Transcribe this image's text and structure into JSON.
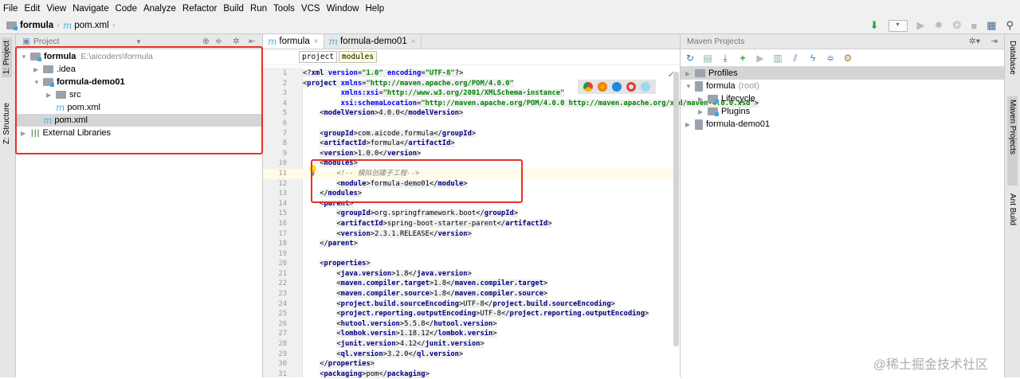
{
  "menu": [
    "File",
    "Edit",
    "View",
    "Navigate",
    "Code",
    "Analyze",
    "Refactor",
    "Build",
    "Run",
    "Tools",
    "VCS",
    "Window",
    "Help"
  ],
  "nav": {
    "project": "formula",
    "file": "pom.xml"
  },
  "left_strip": {
    "project_tab": "1: Project",
    "structure_tab": "Z: Structure"
  },
  "project_panel": {
    "title": "Project",
    "tree": [
      {
        "label": "formula",
        "hint": "E:\\aicoders\\formula",
        "bold": true,
        "depth": 0,
        "arrow": "▼",
        "icon": "module-folder"
      },
      {
        "label": ".idea",
        "depth": 1,
        "arrow": "▶",
        "icon": "folder"
      },
      {
        "label": "formula-demo01",
        "bold": true,
        "depth": 1,
        "arrow": "▼",
        "icon": "module-folder"
      },
      {
        "label": "src",
        "depth": 2,
        "arrow": "▶",
        "icon": "folder"
      },
      {
        "label": "pom.xml",
        "depth": 2,
        "arrow": "",
        "icon": "maven"
      },
      {
        "label": "pom.xml",
        "depth": 1,
        "arrow": "",
        "icon": "maven",
        "selected": true
      },
      {
        "label": "External Libraries",
        "depth": 0,
        "arrow": "▶",
        "icon": "library"
      }
    ]
  },
  "editor": {
    "tabs": [
      {
        "label": "formula",
        "active": true
      },
      {
        "label": "formula-demo01",
        "active": false
      }
    ],
    "breadcrumbs": [
      "project",
      "modules"
    ],
    "lines": [
      [
        [
          "br",
          "<?"
        ],
        [
          "tag",
          "xml "
        ],
        [
          "attr",
          "version"
        ],
        [
          "br",
          "="
        ],
        [
          "val",
          "\"1.0\" "
        ],
        [
          "attr",
          "encoding"
        ],
        [
          "br",
          "="
        ],
        [
          "val",
          "\"UTF-8\""
        ],
        [
          "br",
          "?>"
        ]
      ],
      [
        [
          "br",
          "<"
        ],
        [
          "tag",
          "project "
        ],
        [
          "attr",
          "xmlns"
        ],
        [
          "br",
          "="
        ],
        [
          "val",
          "\"http://maven.apache.org/POM/4.0.0\""
        ]
      ],
      [
        [
          "txt",
          "         "
        ],
        [
          "attr",
          "xmlns:xsi"
        ],
        [
          "br",
          "="
        ],
        [
          "val",
          "\"http://www.w3.org/2001/XMLSchema-instance\""
        ]
      ],
      [
        [
          "txt",
          "         "
        ],
        [
          "attr",
          "xsi:schemaLocation"
        ],
        [
          "br",
          "="
        ],
        [
          "val",
          "\"http://maven.apache.org/POM/4.0.0 http://maven.apache.org/xsd/maven-4.0.0.xsd\""
        ],
        [
          "br",
          ">"
        ]
      ],
      [
        [
          "txt",
          "    "
        ],
        [
          "br",
          "<"
        ],
        [
          "tag",
          "modelVersion"
        ],
        [
          "br",
          ">"
        ],
        [
          "txt",
          "4.0.0"
        ],
        [
          "br",
          "</"
        ],
        [
          "tag",
          "modelVersion"
        ],
        [
          "br",
          ">"
        ]
      ],
      [],
      [
        [
          "txt",
          "    "
        ],
        [
          "br",
          "<"
        ],
        [
          "tag",
          "groupId"
        ],
        [
          "br",
          ">"
        ],
        [
          "txt",
          "com.aicode.formula"
        ],
        [
          "br",
          "</"
        ],
        [
          "tag",
          "groupId"
        ],
        [
          "br",
          ">"
        ]
      ],
      [
        [
          "txt",
          "    "
        ],
        [
          "br",
          "<"
        ],
        [
          "tag",
          "artifactId"
        ],
        [
          "br",
          ">"
        ],
        [
          "txt",
          "formula"
        ],
        [
          "br",
          "</"
        ],
        [
          "tag",
          "artifactId"
        ],
        [
          "br",
          ">"
        ]
      ],
      [
        [
          "txt",
          "    "
        ],
        [
          "br",
          "<"
        ],
        [
          "tag",
          "version"
        ],
        [
          "br",
          ">"
        ],
        [
          "txt",
          "1.0.0"
        ],
        [
          "br",
          "</"
        ],
        [
          "tag",
          "version"
        ],
        [
          "br",
          ">"
        ]
      ],
      [
        [
          "txt",
          "    "
        ],
        [
          "br",
          "<"
        ],
        [
          "tag",
          "modules"
        ],
        [
          "br",
          ">"
        ]
      ],
      [
        [
          "txt",
          "        "
        ],
        [
          "cm",
          "<!-- 模拟创建子工程-->"
        ]
      ],
      [
        [
          "txt",
          "        "
        ],
        [
          "br",
          "<"
        ],
        [
          "tag",
          "module"
        ],
        [
          "br",
          ">"
        ],
        [
          "txt",
          "formula-demo01"
        ],
        [
          "br",
          "</"
        ],
        [
          "tag",
          "module"
        ],
        [
          "br",
          ">"
        ]
      ],
      [
        [
          "txt",
          "    "
        ],
        [
          "br",
          "</"
        ],
        [
          "tag",
          "modules"
        ],
        [
          "br",
          ">"
        ]
      ],
      [
        [
          "txt",
          "    "
        ],
        [
          "br",
          "<"
        ],
        [
          "tag",
          "parent"
        ],
        [
          "br",
          ">"
        ]
      ],
      [
        [
          "txt",
          "        "
        ],
        [
          "br",
          "<"
        ],
        [
          "tag",
          "groupId"
        ],
        [
          "br",
          ">"
        ],
        [
          "txt",
          "org.springframework.boot"
        ],
        [
          "br",
          "</"
        ],
        [
          "tag",
          "groupId"
        ],
        [
          "br",
          ">"
        ]
      ],
      [
        [
          "txt",
          "        "
        ],
        [
          "br",
          "<"
        ],
        [
          "tag",
          "artifactId"
        ],
        [
          "br",
          ">"
        ],
        [
          "txt",
          "spring-boot-starter-parent"
        ],
        [
          "br",
          "</"
        ],
        [
          "tag",
          "artifactId"
        ],
        [
          "br",
          ">"
        ]
      ],
      [
        [
          "txt",
          "        "
        ],
        [
          "br",
          "<"
        ],
        [
          "tag",
          "version"
        ],
        [
          "br",
          ">"
        ],
        [
          "txt",
          "2.3.1.RELEASE"
        ],
        [
          "br",
          "</"
        ],
        [
          "tag",
          "version"
        ],
        [
          "br",
          ">"
        ]
      ],
      [
        [
          "txt",
          "    "
        ],
        [
          "br",
          "</"
        ],
        [
          "tag",
          "parent"
        ],
        [
          "br",
          ">"
        ]
      ],
      [],
      [
        [
          "txt",
          "    "
        ],
        [
          "br",
          "<"
        ],
        [
          "tag",
          "properties"
        ],
        [
          "br",
          ">"
        ]
      ],
      [
        [
          "txt",
          "        "
        ],
        [
          "br",
          "<"
        ],
        [
          "tag",
          "java.version"
        ],
        [
          "br",
          ">"
        ],
        [
          "txt",
          "1.8"
        ],
        [
          "br",
          "</"
        ],
        [
          "tag",
          "java.version"
        ],
        [
          "br",
          ">"
        ]
      ],
      [
        [
          "txt",
          "        "
        ],
        [
          "br",
          "<"
        ],
        [
          "tag",
          "maven.compiler.target"
        ],
        [
          "br",
          ">"
        ],
        [
          "txt",
          "1.8"
        ],
        [
          "br",
          "</"
        ],
        [
          "tag",
          "maven.compiler.target"
        ],
        [
          "br",
          ">"
        ]
      ],
      [
        [
          "txt",
          "        "
        ],
        [
          "br",
          "<"
        ],
        [
          "tag",
          "maven.compiler.source"
        ],
        [
          "br",
          ">"
        ],
        [
          "txt",
          "1.8"
        ],
        [
          "br",
          "</"
        ],
        [
          "tag",
          "maven.compiler.source"
        ],
        [
          "br",
          ">"
        ]
      ],
      [
        [
          "txt",
          "        "
        ],
        [
          "br",
          "<"
        ],
        [
          "tag",
          "project.build.sourceEncoding"
        ],
        [
          "br",
          ">"
        ],
        [
          "txt",
          "UTF-8"
        ],
        [
          "br",
          "</"
        ],
        [
          "tag",
          "project.build.sourceEncoding"
        ],
        [
          "br",
          ">"
        ]
      ],
      [
        [
          "txt",
          "        "
        ],
        [
          "br",
          "<"
        ],
        [
          "tag",
          "project.reporting.outputEncoding"
        ],
        [
          "br",
          ">"
        ],
        [
          "txt",
          "UTF-8"
        ],
        [
          "br",
          "</"
        ],
        [
          "tag",
          "project.reporting.outputEncoding"
        ],
        [
          "br",
          ">"
        ]
      ],
      [
        [
          "txt",
          "        "
        ],
        [
          "br",
          "<"
        ],
        [
          "tag",
          "hutool.version"
        ],
        [
          "br",
          ">"
        ],
        [
          "txt",
          "5.5.8"
        ],
        [
          "br",
          "</"
        ],
        [
          "tag",
          "hutool.version"
        ],
        [
          "br",
          ">"
        ]
      ],
      [
        [
          "txt",
          "        "
        ],
        [
          "br",
          "<"
        ],
        [
          "tag",
          "lombok.versin"
        ],
        [
          "br",
          ">"
        ],
        [
          "txt",
          "1.18.12"
        ],
        [
          "br",
          "</"
        ],
        [
          "tag",
          "lombok.versin"
        ],
        [
          "br",
          ">"
        ]
      ],
      [
        [
          "txt",
          "        "
        ],
        [
          "br",
          "<"
        ],
        [
          "tag",
          "junit.version"
        ],
        [
          "br",
          ">"
        ],
        [
          "txt",
          "4.12"
        ],
        [
          "br",
          "</"
        ],
        [
          "tag",
          "junit.version"
        ],
        [
          "br",
          ">"
        ]
      ],
      [
        [
          "txt",
          "        "
        ],
        [
          "br",
          "<"
        ],
        [
          "tag",
          "ql.version"
        ],
        [
          "br",
          ">"
        ],
        [
          "txt",
          "3.2.0"
        ],
        [
          "br",
          "</"
        ],
        [
          "tag",
          "ql.version"
        ],
        [
          "br",
          ">"
        ]
      ],
      [
        [
          "txt",
          "    "
        ],
        [
          "br",
          "</"
        ],
        [
          "tag",
          "properties"
        ],
        [
          "br",
          ">"
        ]
      ],
      [
        [
          "txt",
          "    "
        ],
        [
          "br",
          "<"
        ],
        [
          "tag",
          "packaging"
        ],
        [
          "br",
          ">"
        ],
        [
          "txt",
          "pom"
        ],
        [
          "br",
          "</"
        ],
        [
          "tag",
          "packaging"
        ],
        [
          "br",
          ">"
        ]
      ]
    ]
  },
  "maven": {
    "title": "Maven Projects",
    "tree": [
      {
        "label": "Profiles",
        "depth": 0,
        "arrow": "▶",
        "selected": true
      },
      {
        "label": "formula",
        "hint": "(root)",
        "depth": 0,
        "arrow": "▼"
      },
      {
        "label": "Lifecycle",
        "depth": 1,
        "arrow": "▶"
      },
      {
        "label": "Plugins",
        "depth": 1,
        "arrow": "▶"
      },
      {
        "label": "formula-demo01",
        "depth": 0,
        "arrow": "▶"
      }
    ]
  },
  "right_strip": {
    "database": "Database",
    "maven": "Maven Projects",
    "ant": "Ant Build"
  },
  "watermark": "@稀土掘金技术社区",
  "colors": {
    "highlight": "#e8302a",
    "tag": "#000080",
    "attr": "#0000ff",
    "value": "#008000"
  }
}
